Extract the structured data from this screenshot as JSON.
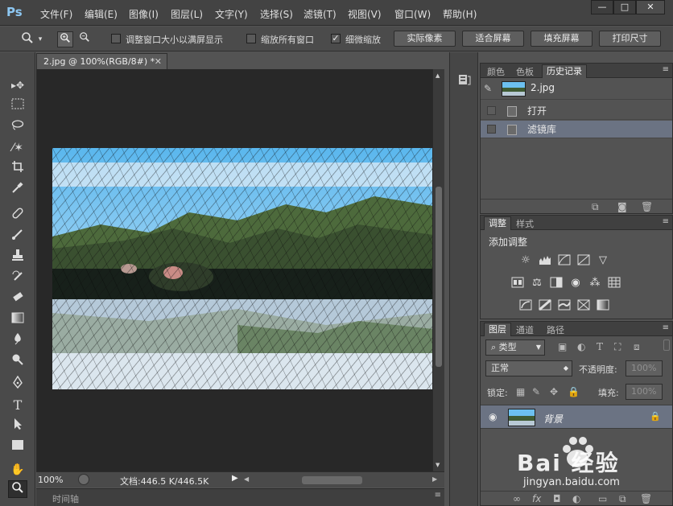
{
  "app": {
    "logo": "Ps"
  },
  "menu": [
    "文件(F)",
    "编辑(E)",
    "图像(I)",
    "图层(L)",
    "文字(Y)",
    "选择(S)",
    "滤镜(T)",
    "视图(V)",
    "窗口(W)",
    "帮助(H)"
  ],
  "window_controls": [
    "—",
    "□",
    "✕"
  ],
  "options": {
    "resize_windows_label": "调整窗口大小以满屏显示",
    "zoom_all_windows_label": "缩放所有窗口",
    "scrubby_zoom_label": "细微缩放",
    "scrubby_zoom_checked": true,
    "buttons": [
      "实际像素",
      "适合屏幕",
      "填充屏幕",
      "打印尺寸"
    ]
  },
  "document": {
    "tab_title": "2.jpg @ 100%(RGB/8#) *",
    "zoom": "100%",
    "doc_info": "文档:446.5 K/446.5K",
    "timeline_label": "时间轴"
  },
  "history_panel": {
    "tabs": [
      "颜色",
      "色板",
      "历史记录"
    ],
    "snapshot": "2.jpg",
    "items": [
      {
        "label": "打开",
        "selected": false
      },
      {
        "label": "滤镜库",
        "selected": true
      }
    ]
  },
  "adjustments_panel": {
    "tabs": [
      "调整",
      "样式"
    ],
    "title": "添加调整"
  },
  "layers_panel": {
    "tabs": [
      "图层",
      "通道",
      "路径"
    ],
    "filter_kind": "类型",
    "blend_mode": "正常",
    "opacity_label": "不透明度:",
    "opacity_value": "100%",
    "lock_label": "锁定:",
    "fill_label": "填充:",
    "fill_value": "100%",
    "layer_name": "背景"
  },
  "watermark": {
    "brand": "Bai 经验",
    "url": "jingyan.baidu.com"
  },
  "colors": {
    "accent": "#8dc7f2",
    "selection": "#6b7383",
    "canvas_bg": "#282828"
  }
}
